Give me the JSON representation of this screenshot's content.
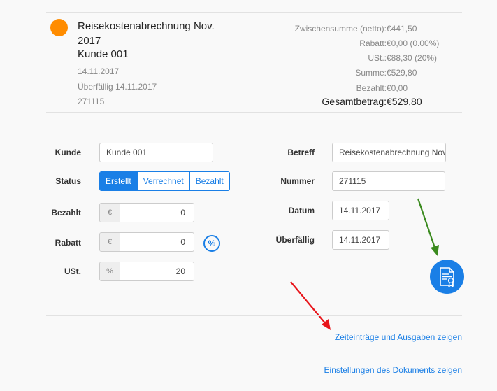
{
  "invoice": {
    "title": "Reisekostenabrechnung Nov. 2017",
    "client": "Kunde 001",
    "date": "14.11.2017",
    "overdue": "Überfällig 14.11.2017",
    "number": "271115",
    "status_color": "#ff8c00"
  },
  "summary": {
    "rows": [
      {
        "label": "Zwischensumme (netto):",
        "value": "€441,50"
      },
      {
        "label": "Rabatt:",
        "value": "€0,00 (0.00%)"
      },
      {
        "label": "USt.:",
        "value": "€88,30 (20%)"
      },
      {
        "label": "Summe:",
        "value": "€529,80"
      },
      {
        "label": "Bezahlt:",
        "value": "€0,00"
      }
    ],
    "total_label": "Gesamtbetrag:",
    "total_value": "€529,80"
  },
  "form": {
    "kunde": {
      "label": "Kunde",
      "value": "Kunde 001"
    },
    "status": {
      "label": "Status",
      "options": [
        "Erstellt",
        "Verrechnet",
        "Bezahlt"
      ],
      "selected": "Erstellt"
    },
    "bezahlt": {
      "label": "Bezahlt",
      "addon": "€",
      "value": "0"
    },
    "rabatt": {
      "label": "Rabatt",
      "addon": "€",
      "value": "0",
      "toggle": "%"
    },
    "ust": {
      "label": "USt.",
      "addon": "%",
      "value": "20"
    },
    "betreff": {
      "label": "Betreff",
      "value": "Reisekostenabrechnung Nov."
    },
    "nummer": {
      "label": "Nummer",
      "value": "271115"
    },
    "datum": {
      "label": "Datum",
      "value": "14.11.2017"
    },
    "ueberfaellig": {
      "label": "Überfällig",
      "value": "14.11.2017"
    }
  },
  "links": {
    "time_entries": "Zeiteinträge und Ausgaben zeigen",
    "doc_settings": "Einstellungen des Dokuments zeigen"
  },
  "icons": {
    "document_button": "document-certificate-icon"
  },
  "accent_color": "#1a7fe6"
}
